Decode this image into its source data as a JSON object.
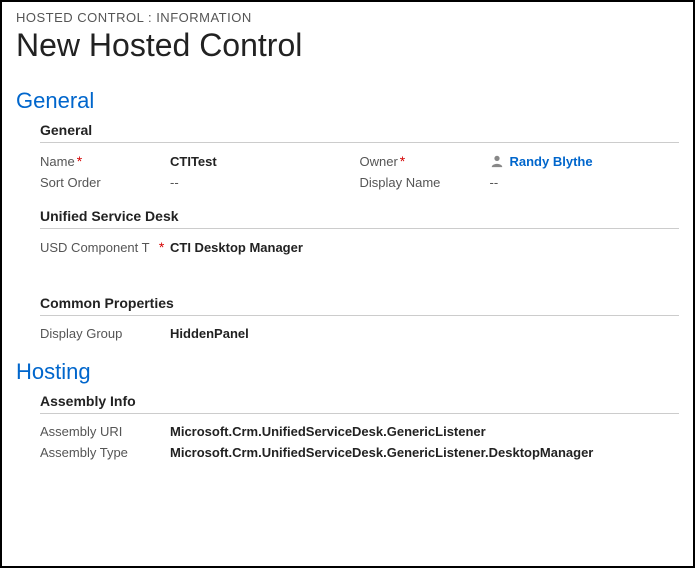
{
  "breadcrumb": "HOSTED CONTROL : INFORMATION",
  "page_title": "New Hosted Control",
  "sections": {
    "general": {
      "header": "General",
      "sub_general": {
        "title": "General",
        "name_label": "Name",
        "name_value": "CTITest",
        "owner_label": "Owner",
        "owner_value": "Randy Blythe",
        "sort_order_label": "Sort Order",
        "sort_order_value": "--",
        "display_name_label": "Display Name",
        "display_name_value": "--"
      },
      "sub_usd": {
        "title": "Unified Service Desk",
        "component_label": "USD Component T",
        "component_value": "CTI Desktop Manager"
      },
      "sub_common": {
        "title": "Common Properties",
        "display_group_label": "Display Group",
        "display_group_value": "HiddenPanel"
      }
    },
    "hosting": {
      "header": "Hosting",
      "sub_assembly": {
        "title": "Assembly Info",
        "uri_label": "Assembly URI",
        "uri_value": "Microsoft.Crm.UnifiedServiceDesk.GenericListener",
        "type_label": "Assembly Type",
        "type_value": "Microsoft.Crm.UnifiedServiceDesk.GenericListener.DesktopManager"
      }
    }
  }
}
